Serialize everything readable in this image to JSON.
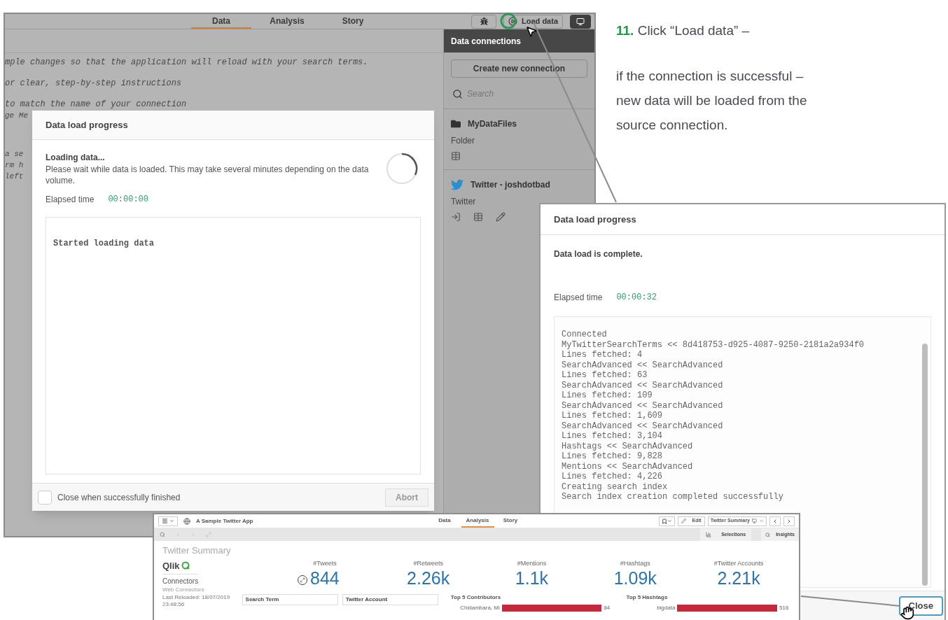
{
  "background_app": {
    "tabs": [
      {
        "label": "Data",
        "selected": true
      },
      {
        "label": "Analysis",
        "selected": false
      },
      {
        "label": "Story",
        "selected": false
      }
    ],
    "load_button": "Load data",
    "script_lines": [
      "mple changes so that the application will reload with your search terms.",
      "or clear, step-by-step instructions",
      "to match the name of your connection"
    ],
    "side_fragments": [
      "ge Me",
      "a se",
      "rm h",
      "left"
    ],
    "data_connections": {
      "title": "Data connections",
      "create_button": "Create new connection",
      "search_placeholder": "Search",
      "connections": [
        {
          "kind": "folder",
          "name": "MyDataFiles",
          "type": "Folder"
        },
        {
          "kind": "twitter",
          "name": "Twitter - joshdotbad",
          "type": "Twitter"
        }
      ]
    }
  },
  "loading_dialog": {
    "title": "Data load progress",
    "status": "Loading data...",
    "message": "Please wait while data is loaded. This may take several minutes depending on the data volume.",
    "elapsed_label": "Elapsed time",
    "elapsed_value": "00:00:00",
    "log": [
      "Started loading data"
    ],
    "checkbox": {
      "label": "Close when successfully finished",
      "checked": false
    },
    "abort_button": "Abort"
  },
  "instruction": {
    "step": "11.",
    "heading": "Click “Load data” –",
    "text": "if the connection is successful – new data will be loaded from the source connection."
  },
  "complete_dialog": {
    "title": "Data load progress",
    "status": "Data load is complete.",
    "elapsed_label": "Elapsed time",
    "elapsed_value": "00:00:32",
    "log": [
      "Connected",
      "MyTwitterSearchTerms << 8d418753-d925-4087-9250-2181a2a934f0",
      "Lines fetched: 4",
      "SearchAdvanced << SearchAdvanced",
      "Lines fetched: 63",
      "SearchAdvanced << SearchAdvanced",
      "Lines fetched: 109",
      "SearchAdvanced << SearchAdvanced",
      "Lines fetched: 1,609",
      "SearchAdvanced << SearchAdvanced",
      "Lines fetched: 3,104",
      "Hashtags << SearchAdvanced",
      "Lines fetched: 9,828",
      "Mentions << SearchAdvanced",
      "Lines fetched: 4,226",
      "Creating search index",
      "Search index creation completed successfully"
    ],
    "close_button": "Close"
  },
  "dashboard": {
    "app_title": "A Sample Twitter App",
    "tabs": [
      {
        "label": "Data",
        "selected": false
      },
      {
        "label": "Analysis",
        "selected": true
      },
      {
        "label": "Story",
        "selected": false
      }
    ],
    "edit_button": "Edit",
    "sheet_selector": "Twitter Summary",
    "selections_button": "Selections",
    "insights_button": "Insights",
    "sheet_title": "Twitter Summary",
    "logo": "Qlik",
    "logo_sub": "Connectors",
    "logo_caption": "Web Connectors",
    "kpis": [
      {
        "label": "#Tweets",
        "value": "844"
      },
      {
        "label": "#Retweets",
        "value": "2.26k"
      },
      {
        "label": "#Mentions",
        "value": "1.1k"
      },
      {
        "label": "#Hashtags",
        "value": "1.09k"
      },
      {
        "label": "#Twitter Accounts",
        "value": "2.21k"
      }
    ],
    "last_reloaded": "Last Reloaded: 18/07/2019",
    "reload_time": "23:48:56",
    "filters": [
      "Search Term",
      "Twitter Account"
    ],
    "charts": [
      {
        "title": "Top 5 Contributors",
        "bar_label": "Chidambara, Mi",
        "bar_value": "84"
      },
      {
        "title": "Top 5 Hashtags",
        "bar_label": "bigdata",
        "bar_value": "516"
      }
    ]
  }
}
